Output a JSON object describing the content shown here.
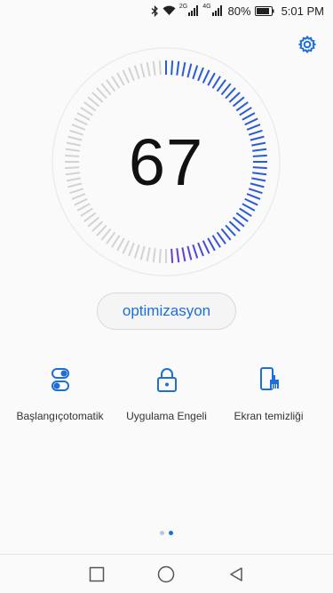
{
  "status_bar": {
    "network_2g": "2G",
    "network_4g": "4G",
    "battery_percent": "80%",
    "time": "5:01 PM"
  },
  "score": {
    "value": "67",
    "fraction": 0.67
  },
  "optimize_button": {
    "label": "optimizasyon"
  },
  "features": [
    {
      "label": "Başlangıçotomatik",
      "icon": "toggle-icon"
    },
    {
      "label": "Uygulama Engeli",
      "icon": "lock-icon"
    },
    {
      "label": "Ekran temizliği",
      "icon": "phone-clean-icon"
    }
  ],
  "pager": {
    "pages": 2,
    "active": 1
  },
  "colors": {
    "accent": "#1d6fd6",
    "dial_active_start": "#2a5bd7",
    "dial_active_end": "#6a3bd1",
    "dial_inactive": "#d3d3d3"
  },
  "navigation": {
    "buttons": [
      "recent-apps",
      "home",
      "back"
    ]
  }
}
